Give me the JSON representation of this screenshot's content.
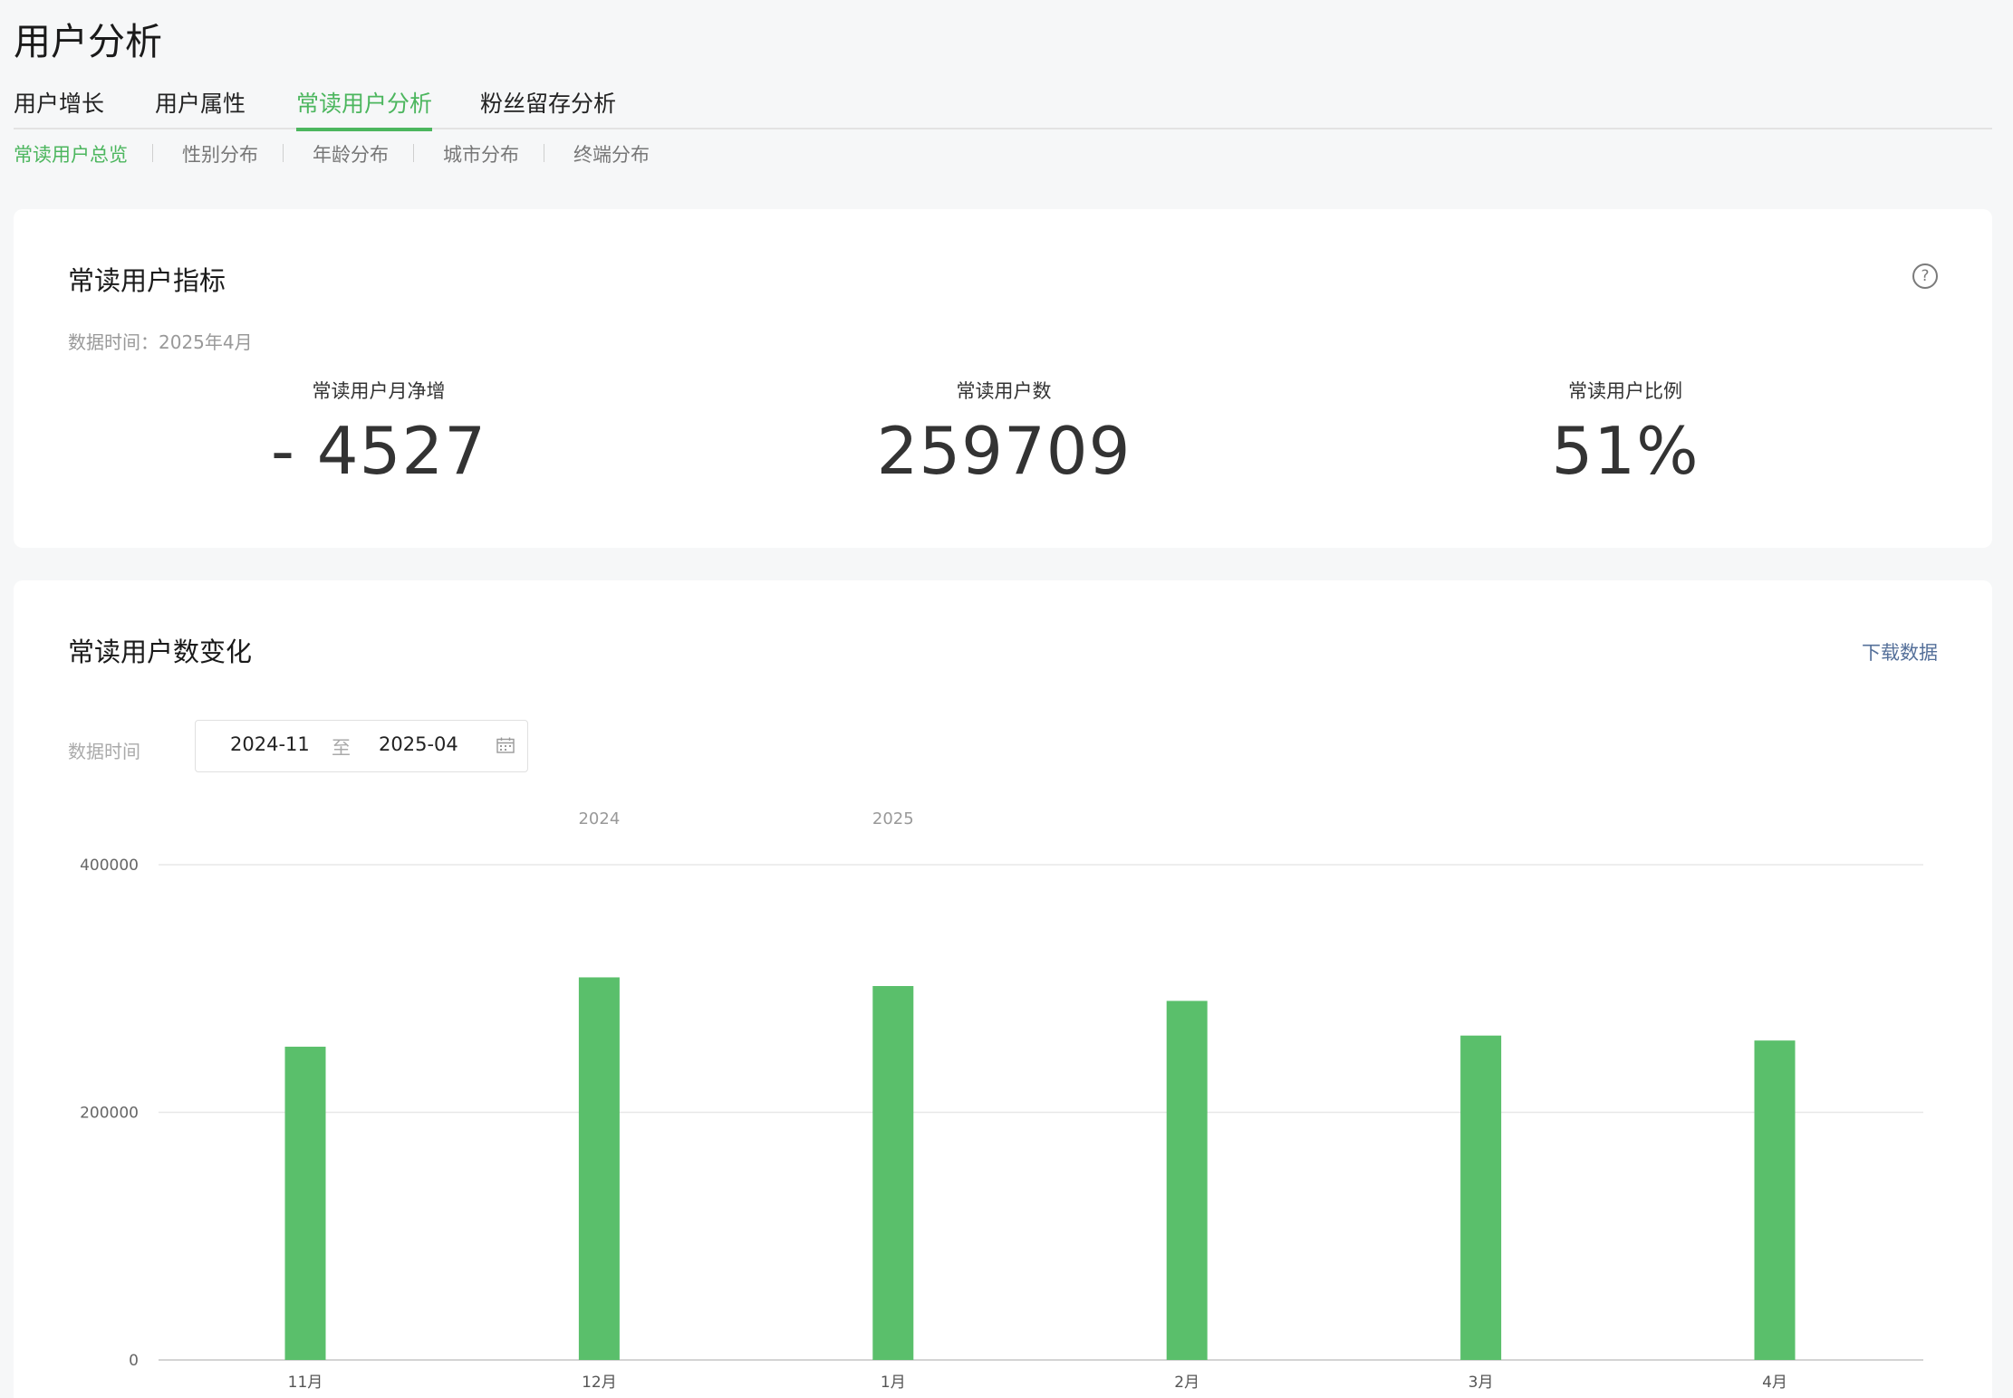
{
  "page": {
    "title": "用户分析"
  },
  "main_tabs": [
    "用户增长",
    "用户属性",
    "常读用户分析",
    "粉丝留存分析"
  ],
  "sub_tabs": [
    "常读用户总览",
    "性别分布",
    "年龄分布",
    "城市分布",
    "终端分布"
  ],
  "metrics_card": {
    "title": "常读用户指标",
    "data_time": "数据时间：2025年4月",
    "metrics": [
      {
        "label": "常读用户月净增",
        "value": "- 4527"
      },
      {
        "label": "常读用户数",
        "value": "259709"
      },
      {
        "label": "常读用户比例",
        "value": "51%"
      }
    ]
  },
  "trend_card": {
    "title": "常读用户数变化",
    "download_label": "下载数据",
    "date_label": "数据时间",
    "date_start": "2024-11",
    "date_separator": "至",
    "date_end": "2025-04"
  },
  "icons": {
    "help": "help-circle-icon",
    "calendar": "calendar-icon"
  },
  "colors": {
    "accent": "#4cb65e",
    "bar": "#5abf6b",
    "link": "#55709a"
  },
  "chart_data": {
    "type": "bar",
    "categories": [
      "11月",
      "12月",
      "1月",
      "2月",
      "3月",
      "4月"
    ],
    "year_labels": [
      {
        "label": "2024",
        "at": "12月"
      },
      {
        "label": "2025",
        "at": "1月"
      }
    ],
    "values": [
      253000,
      309000,
      302000,
      290000,
      262000,
      258000
    ],
    "yticks": [
      "400000",
      "200000",
      "0"
    ],
    "ylim": [
      0,
      400000
    ],
    "grid": true,
    "legend": false
  }
}
